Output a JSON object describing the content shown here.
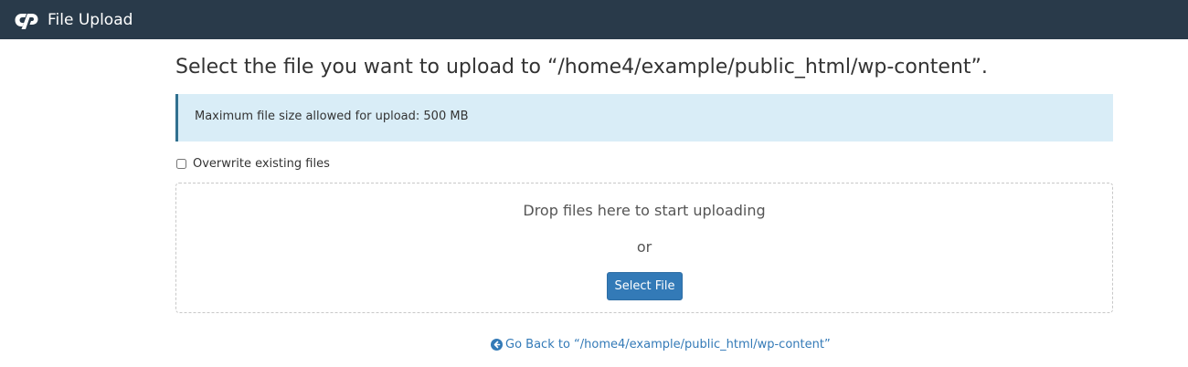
{
  "header": {
    "logo_icon": "cpanel-logo-icon",
    "title": "File Upload",
    "background": "#293a4a"
  },
  "main": {
    "title": "Select the file you want to upload to “/home4/example/public_html/wp-content”.",
    "alert": {
      "text": "Maximum file size allowed for upload: 500 MB",
      "background": "#d9edf7"
    },
    "overwrite": {
      "label": "Overwrite existing files",
      "checked": false
    },
    "dropzone": {
      "drop_text": "Drop files here to start uploading",
      "or_text": "or",
      "select_button": "Select File"
    },
    "go_back": {
      "icon": "circle-arrow-left-icon",
      "label": "Go Back to “/home4/example/public_html/wp-content”"
    }
  },
  "colors": {
    "accent": "#337ab7"
  }
}
